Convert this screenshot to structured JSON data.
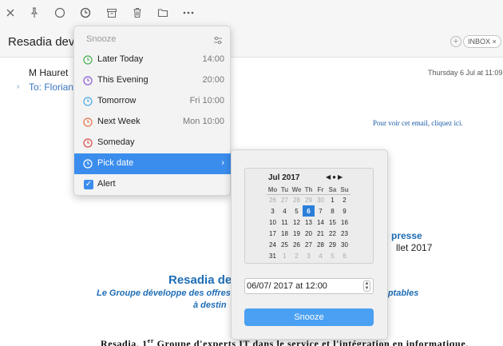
{
  "colors": {
    "accent": "#3b8ded",
    "link": "#1e6db5"
  },
  "toolbar": {
    "buttons": [
      "close-icon",
      "pin-icon",
      "circle-icon",
      "clock-icon",
      "archive-icon",
      "trash-icon",
      "folder-icon",
      "more-icon"
    ]
  },
  "header": {
    "subject": "Resadia devie",
    "label": "INBOX ×"
  },
  "message": {
    "sender": "M Hauret",
    "recipient": "To: Florian",
    "date": "Thursday 6 Jul at 11:09",
    "web_link": "Pour voir cet email, cliquez ici.",
    "press_title": "e presse",
    "press_date": "llet 2017",
    "company_heading": "Resadia dev",
    "tagline_start": "Le Groupe développe des offres",
    "tagline_end": "daptables",
    "tagline_line2": "à destin",
    "body_prefix": "Resadia, 1",
    "body_sup": "er",
    "body_rest": " Groupe d'experts IT dans le service et l'intégration en informatique,"
  },
  "snooze_menu": {
    "title": "Snooze",
    "items": [
      {
        "label": "Later Today",
        "time": "14:00",
        "icon": "clock-icon",
        "color": "#4caf50"
      },
      {
        "label": "This Evening",
        "time": "20:00",
        "icon": "clock-icon",
        "color": "#8e5bd6"
      },
      {
        "label": "Tomorrow",
        "time": "Fri 10:00",
        "icon": "clock-icon",
        "color": "#4aa8e8"
      },
      {
        "label": "Next Week",
        "time": "Mon 10:00",
        "icon": "clock-icon",
        "color": "#e8734a"
      },
      {
        "label": "Someday",
        "time": "",
        "icon": "clock-icon",
        "color": "#e04848"
      },
      {
        "label": "Pick date",
        "time": "",
        "icon": "clock-icon",
        "color": "#ffffff"
      }
    ],
    "alert_label": "Alert",
    "alert_checked": true
  },
  "date_picker": {
    "month": "Jul 2017",
    "weekdays": [
      "Mo",
      "Tu",
      "We",
      "Th",
      "Fr",
      "Sa",
      "Su"
    ],
    "weeks": [
      [
        "26",
        "27",
        "28",
        "29",
        "30",
        "1",
        "2"
      ],
      [
        "3",
        "4",
        "5",
        "6",
        "7",
        "8",
        "9"
      ],
      [
        "10",
        "11",
        "12",
        "13",
        "14",
        "15",
        "16"
      ],
      [
        "17",
        "18",
        "19",
        "20",
        "21",
        "22",
        "23"
      ],
      [
        "24",
        "25",
        "26",
        "27",
        "28",
        "29",
        "30"
      ],
      [
        "31",
        "1",
        "2",
        "3",
        "4",
        "5",
        "6"
      ]
    ],
    "selected_day": "6",
    "datetime_value": "06/07/ 2017 at  12:00",
    "snooze_button": "Snooze"
  }
}
